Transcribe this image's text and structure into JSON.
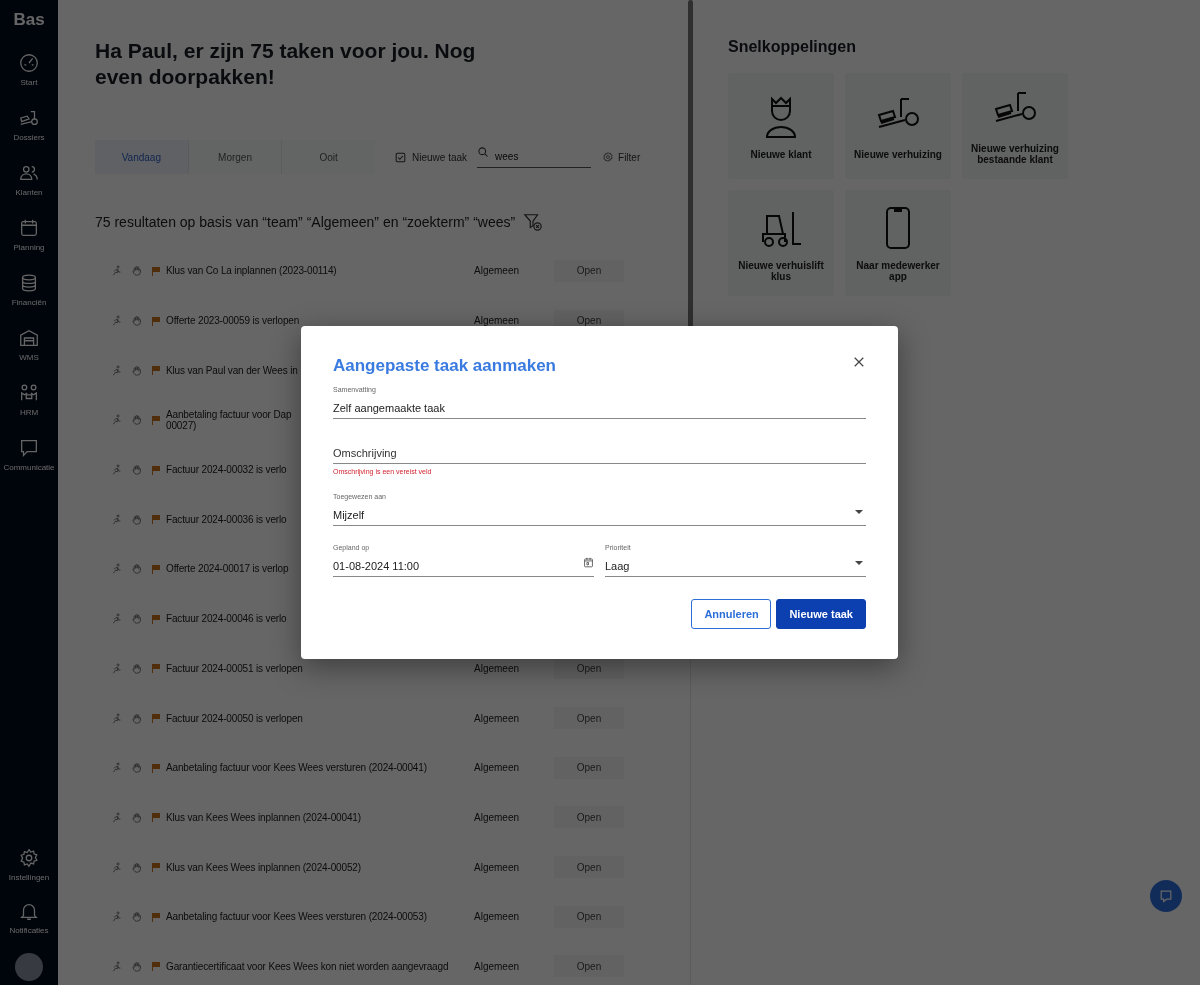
{
  "sidebar": {
    "logo": "Bas",
    "items": [
      {
        "label": "Start",
        "kind": "gauge"
      },
      {
        "label": "Dossiers",
        "kind": "scooter"
      },
      {
        "label": "Klanten",
        "kind": "people"
      },
      {
        "label": "Planning",
        "kind": "calendar"
      },
      {
        "label": "Financiën",
        "kind": "coins"
      },
      {
        "label": "WMS",
        "kind": "warehouse"
      },
      {
        "label": "HRM",
        "kind": "team"
      },
      {
        "label": "Communicatie",
        "kind": "chat"
      }
    ],
    "bottom_items": [
      {
        "label": "Instellingen",
        "kind": "gear"
      },
      {
        "label": "Notificaties",
        "kind": "bell"
      }
    ]
  },
  "greeting": "Ha Paul, er zijn 75 taken voor jou. Nog even doorpakken!",
  "tabs": [
    {
      "label": "Vandaag",
      "selected": true
    },
    {
      "label": "Morgen",
      "selected": false
    },
    {
      "label": "Ooit",
      "selected": false
    }
  ],
  "toolbar": {
    "checkbox": {
      "label": "Nieuwe taak",
      "checked": true
    },
    "search": {
      "value": "wees"
    },
    "filter": "Filter"
  },
  "results_summary": "75 resultaten op basis van “team” “Algemeen” en “zoekterm” “wees”",
  "tasks": [
    {
      "title": "Klus van Co La inplannen (2023-00114)",
      "category": "Algemeen",
      "status": "Open"
    },
    {
      "title": "Offerte 2023-00059 is verlopen",
      "category": "Algemeen",
      "status": "Open"
    },
    {
      "title": "Klus van Paul van der Wees in"
    },
    {
      "title": "Aanbetaling factuur voor Dap",
      "title_line_2": "00027)"
    },
    {
      "title": "Factuur 2024-00032 is verlo"
    },
    {
      "title": "Factuur 2024-00036 is verlo"
    },
    {
      "title": "Offerte 2024-00017 is verlop"
    },
    {
      "title": "Factuur 2024-00046 is verlo"
    },
    {
      "title": "Factuur 2024-00051 is verlopen",
      "category": "Algemeen",
      "status": "Open"
    },
    {
      "title": "Factuur 2024-00050 is verlopen",
      "category": "Algemeen",
      "status": "Open"
    },
    {
      "title": "Aanbetaling factuur voor Kees Wees versturen (2024-00041)",
      "category": "Algemeen",
      "status": "Open"
    },
    {
      "title": "Klus van Kees Wees inplannen (2024-00041)",
      "category": "Algemeen",
      "status": "Open"
    },
    {
      "title": "Klus van Kees Wees inplannen (2024-00052)",
      "category": "Algemeen",
      "status": "Open"
    },
    {
      "title": "Aanbetaling factuur voor Kees Wees versturen (2024-00053)",
      "category": "Algemeen",
      "status": "Open"
    },
    {
      "title": "Garantiecertificaat voor Kees Wees kon niet worden aangevraagd",
      "category": "Algemeen",
      "status": "Open"
    }
  ],
  "shortcuts": {
    "title": "Snelkoppelingen",
    "items": [
      {
        "label": "Nieuwe klant",
        "kind": "person"
      },
      {
        "label": "Nieuwe verhuizing",
        "kind": "scooter"
      },
      {
        "label": "Nieuwe verhuizing bestaande klant",
        "kind": "scooter"
      },
      {
        "label": "Nieuwe verhuislift klus",
        "kind": "forklift"
      },
      {
        "label": "Naar medewerker app",
        "kind": "phone"
      }
    ]
  },
  "dialog": {
    "title": "Aangepaste taak aanmaken",
    "rows": [
      [
        {
          "kind": "text",
          "label": "Samenvatting",
          "value": "Zelf aangemaakte taak"
        }
      ],
      [
        {
          "kind": "text",
          "placeholder": "Omschrijving",
          "error": "Omschrijving is een vereist veld"
        }
      ],
      [
        {
          "kind": "select",
          "label": "Toegewezen aan",
          "value": "Mijzelf"
        }
      ],
      [
        {
          "kind": "date",
          "label": "Gepland op",
          "value": "01-08-2024 11:00"
        },
        {
          "kind": "select",
          "label": "Prioriteit",
          "value": "Laag"
        }
      ]
    ],
    "buttons": [
      {
        "label": "Annuleren",
        "kind": "secondary"
      },
      {
        "label": "Nieuwe taak",
        "kind": "primary"
      }
    ]
  }
}
